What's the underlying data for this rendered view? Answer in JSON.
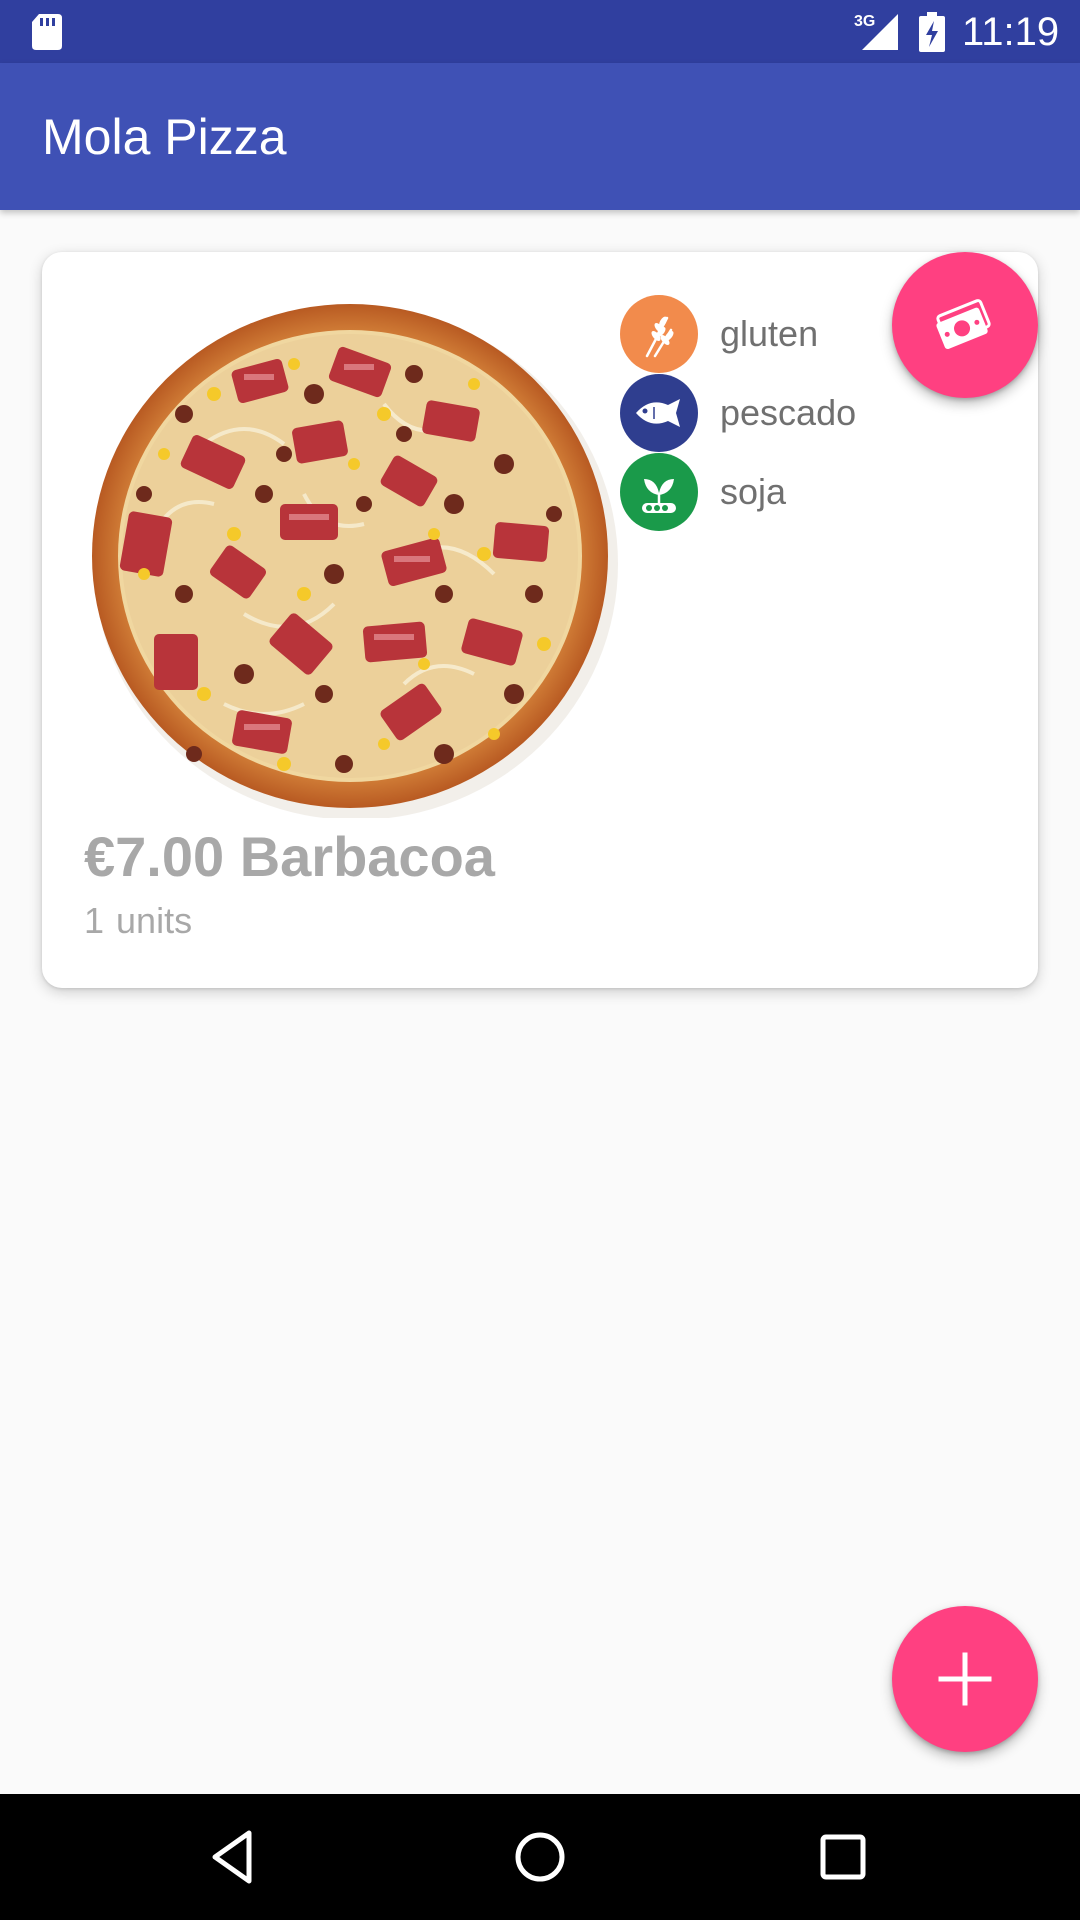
{
  "status_bar": {
    "network": "3G",
    "time": "11:19",
    "icons": [
      "sd-card-icon",
      "signal-icon",
      "battery-charging-icon"
    ]
  },
  "app_bar": {
    "title": "Mola Pizza"
  },
  "product": {
    "price": "€7.00",
    "name": "Barbacoa",
    "quantity": "1",
    "units_label": "units",
    "image": "pizza-barbacoa-photo",
    "allergens": [
      {
        "label": "gluten",
        "icon": "wheat-icon",
        "color": "#f28b4c"
      },
      {
        "label": "pescado",
        "icon": "fish-icon",
        "color": "#2f3e8f"
      },
      {
        "label": "soja",
        "icon": "soy-icon",
        "color": "#1a9a4a"
      }
    ]
  },
  "actions": {
    "pay_icon": "money-icon",
    "add_icon": "plus-icon"
  },
  "colors": {
    "status_bar": "#303f9f",
    "primary": "#3f51b5",
    "accent": "#ff4081",
    "background": "#fafafa",
    "muted_text": "#a8a8a8"
  },
  "nav_bar": {
    "icons": [
      "back-icon",
      "home-icon",
      "recents-icon"
    ]
  }
}
